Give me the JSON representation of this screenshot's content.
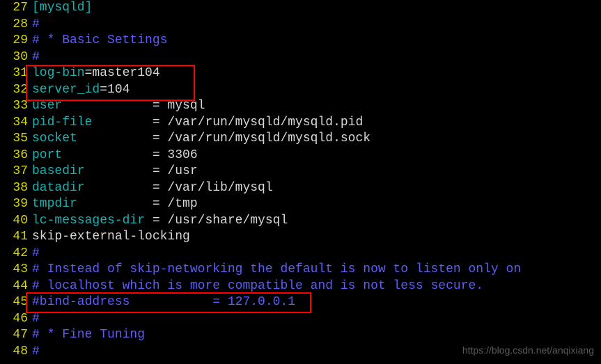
{
  "lines": [
    {
      "n": 27,
      "segs": [
        {
          "t": "[mysqld]",
          "c": "txt-cyan"
        }
      ]
    },
    {
      "n": 28,
      "segs": [
        {
          "t": "#",
          "c": "txt-blue"
        }
      ]
    },
    {
      "n": 29,
      "segs": [
        {
          "t": "# * Basic Settings",
          "c": "txt-blue"
        }
      ]
    },
    {
      "n": 30,
      "segs": [
        {
          "t": "#",
          "c": "txt-blue"
        }
      ]
    },
    {
      "n": 31,
      "segs": [
        {
          "t": "log-bin",
          "c": "txt-cyan"
        },
        {
          "t": "=master104",
          "c": "txt-white"
        }
      ]
    },
    {
      "n": 32,
      "segs": [
        {
          "t": "server_id",
          "c": "txt-cyan"
        },
        {
          "t": "=104",
          "c": "txt-white"
        }
      ]
    },
    {
      "n": 33,
      "segs": [
        {
          "t": "user            ",
          "c": "txt-cyan"
        },
        {
          "t": "= mysql",
          "c": "txt-white"
        }
      ]
    },
    {
      "n": 34,
      "segs": [
        {
          "t": "pid-file        ",
          "c": "txt-cyan"
        },
        {
          "t": "= /var/run/mysqld/mysqld.pid",
          "c": "txt-white"
        }
      ]
    },
    {
      "n": 35,
      "segs": [
        {
          "t": "socket          ",
          "c": "txt-cyan"
        },
        {
          "t": "= /var/run/mysqld/mysqld.sock",
          "c": "txt-white"
        }
      ]
    },
    {
      "n": 36,
      "segs": [
        {
          "t": "port            ",
          "c": "txt-cyan"
        },
        {
          "t": "= 3306",
          "c": "txt-white"
        }
      ]
    },
    {
      "n": 37,
      "segs": [
        {
          "t": "basedir         ",
          "c": "txt-cyan"
        },
        {
          "t": "= /usr",
          "c": "txt-white"
        }
      ]
    },
    {
      "n": 38,
      "segs": [
        {
          "t": "datadir         ",
          "c": "txt-cyan"
        },
        {
          "t": "= /var/lib/mysql",
          "c": "txt-white"
        }
      ]
    },
    {
      "n": 39,
      "segs": [
        {
          "t": "tmpdir          ",
          "c": "txt-cyan"
        },
        {
          "t": "= /tmp",
          "c": "txt-white"
        }
      ]
    },
    {
      "n": 40,
      "segs": [
        {
          "t": "lc-messages-dir ",
          "c": "txt-cyan"
        },
        {
          "t": "= /usr/share/mysql",
          "c": "txt-white"
        }
      ]
    },
    {
      "n": 41,
      "segs": [
        {
          "t": "skip-external-locking",
          "c": "txt-white"
        }
      ]
    },
    {
      "n": 42,
      "segs": [
        {
          "t": "#",
          "c": "txt-blue"
        }
      ]
    },
    {
      "n": 43,
      "segs": [
        {
          "t": "# Instead of skip-networking the default is now to listen only on",
          "c": "txt-blue"
        }
      ]
    },
    {
      "n": 44,
      "segs": [
        {
          "t": "# localhost which is more compatible and is not less secure.",
          "c": "txt-blue"
        }
      ]
    },
    {
      "n": 45,
      "segs": [
        {
          "t": "#bind-address           = 127.0.0.1",
          "c": "txt-blue"
        }
      ]
    },
    {
      "n": 46,
      "segs": [
        {
          "t": "#",
          "c": "txt-blue"
        }
      ]
    },
    {
      "n": 47,
      "segs": [
        {
          "t": "# * Fine Tuning",
          "c": "txt-blue"
        }
      ]
    },
    {
      "n": 48,
      "segs": [
        {
          "t": "#",
          "c": "txt-blue"
        }
      ]
    }
  ],
  "watermark": "https://blog.csdn.net/anqixiang"
}
